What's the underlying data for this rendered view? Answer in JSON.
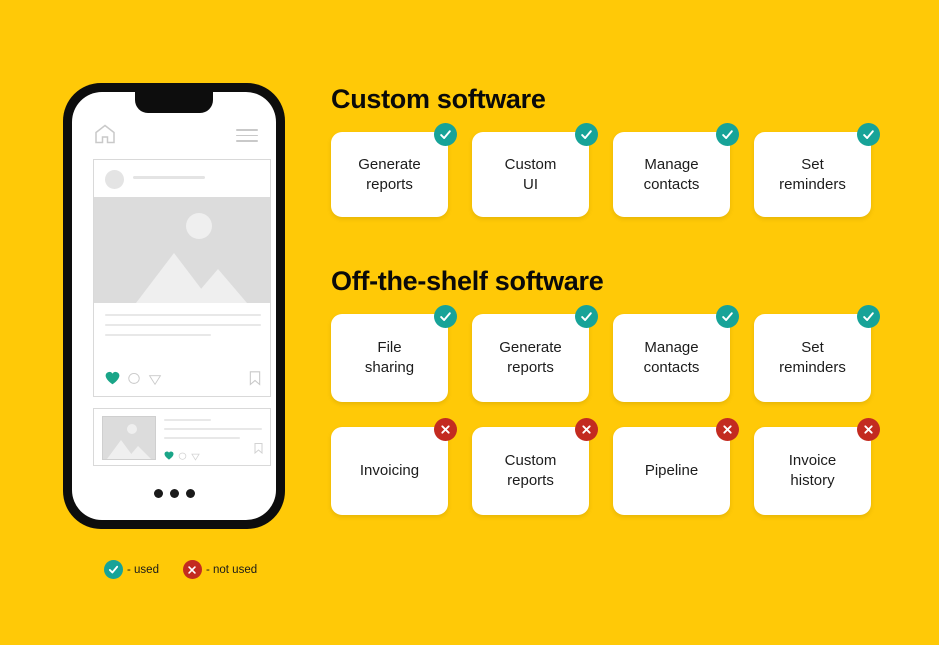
{
  "theme": {
    "background": "#FFC907",
    "card_background": "#FFFFFF",
    "used_color": "#17A398",
    "not_used_color": "#C32B20",
    "text_color": "#1C1C1C"
  },
  "phone": {
    "home_icon": "home-icon",
    "menu_icon": "hamburger-menu-icon",
    "post": {
      "avatar": "avatar-placeholder",
      "image": "image-placeholder",
      "like_icon": "heart-icon",
      "comment_icon": "comment-bubble-icon",
      "share_icon": "send-icon",
      "save_icon": "bookmark-icon"
    },
    "post_small": {
      "thumbnail": "image-placeholder",
      "like_icon": "heart-icon",
      "comment_icon": "comment-bubble-icon",
      "share_icon": "send-icon",
      "save_icon": "bookmark-icon"
    },
    "pagination_dots": 3
  },
  "legend": {
    "used": {
      "icon": "check-circle-icon",
      "label": "- used"
    },
    "not_used": {
      "icon": "x-circle-icon",
      "label": "- not used"
    }
  },
  "sections": [
    {
      "id": "custom",
      "title": "Custom software",
      "rows": [
        [
          {
            "label": "Generate\nreports",
            "status": "used"
          },
          {
            "label": "Custom\nUI",
            "status": "used"
          },
          {
            "label": "Manage\ncontacts",
            "status": "used"
          },
          {
            "label": "Set\nreminders",
            "status": "used"
          }
        ]
      ]
    },
    {
      "id": "off-the-shelf",
      "title": "Off-the-shelf software",
      "rows": [
        [
          {
            "label": "File\nsharing",
            "status": "used"
          },
          {
            "label": "Generate\nreports",
            "status": "used"
          },
          {
            "label": "Manage\ncontacts",
            "status": "used"
          },
          {
            "label": "Set\nreminders",
            "status": "used"
          }
        ],
        [
          {
            "label": "Invoicing",
            "status": "not_used"
          },
          {
            "label": "Custom\nreports",
            "status": "not_used"
          },
          {
            "label": "Pipeline",
            "status": "not_used"
          },
          {
            "label": "Invoice\nhistory",
            "status": "not_used"
          }
        ]
      ]
    }
  ]
}
